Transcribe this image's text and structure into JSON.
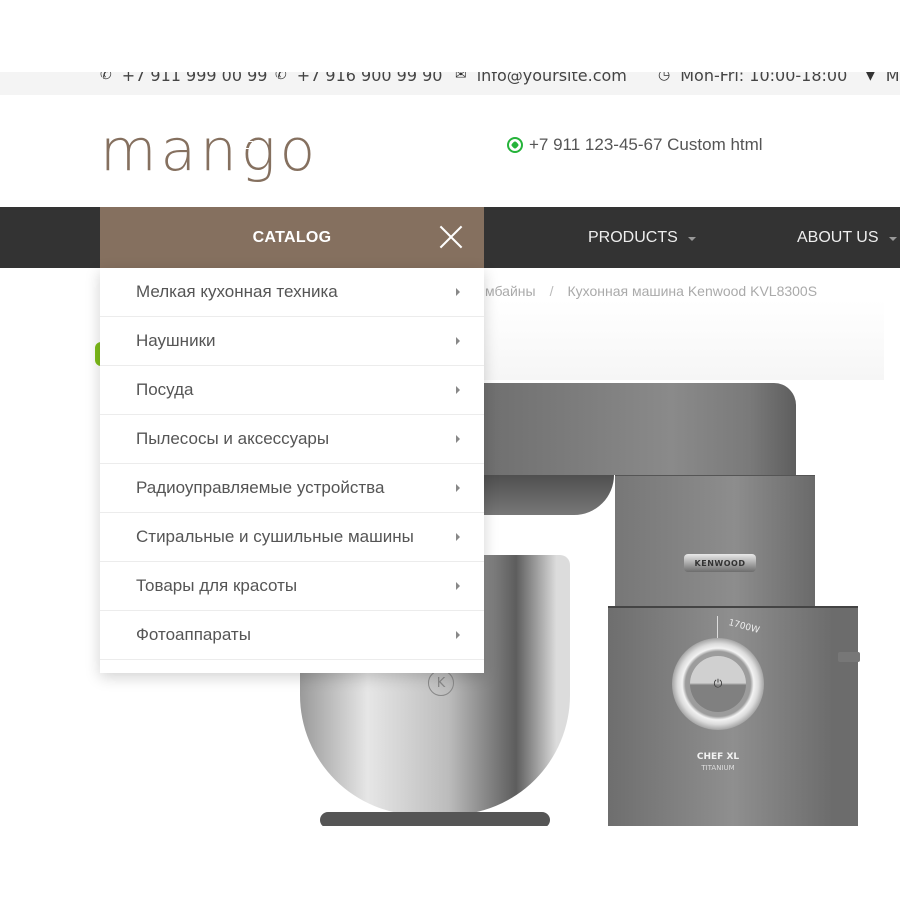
{
  "topbar": {
    "items": [
      {
        "icon": "phone-icon",
        "text": "+7 911 999 00 99"
      },
      {
        "icon": "phone-icon",
        "text": "+7 916 900 99 90"
      },
      {
        "icon": "envelope-icon",
        "text": "info@yoursite.com"
      },
      {
        "icon": "clock-icon",
        "text": "Mon-Fri: 10:00-18:00"
      },
      {
        "icon": "map-marker-icon",
        "text": "M"
      }
    ]
  },
  "header": {
    "logo": {
      "part1": "man",
      "part2": "g",
      "part3": "o"
    },
    "phone": "+7 911 123-45-67 Custom html",
    "phone_icon": "whatsapp-icon"
  },
  "nav": {
    "catalog_label": "CATALOG",
    "items": [
      {
        "label": "PRODUCTS"
      },
      {
        "label": "ABOUT US"
      }
    ]
  },
  "breadcrumb": {
    "items": [
      "мбайны",
      "Кухонная машина Kenwood KVL8300S"
    ],
    "separator": "/"
  },
  "catalog_menu": {
    "items": [
      {
        "label": "Мелкая кухонная техника"
      },
      {
        "label": "Наушники"
      },
      {
        "label": "Посуда"
      },
      {
        "label": "Пылесосы и аксессуары"
      },
      {
        "label": "Радиоуправляемые устройства"
      },
      {
        "label": "Стиральные и сушильные машины"
      },
      {
        "label": "Товары для красоты"
      },
      {
        "label": "Фотоаппараты"
      }
    ]
  },
  "product_image": {
    "brand_badge": "KENWOOD",
    "power_label": "1700W",
    "model_name": "CHEF XL",
    "model_sub": "TITANIUM",
    "power_symbol": "⏻",
    "bowl_logo": "K"
  },
  "colors": {
    "brand": "#85705f",
    "navbar": "#333333",
    "accent_green": "#7ebd1a",
    "whatsapp": "#25b33a"
  }
}
